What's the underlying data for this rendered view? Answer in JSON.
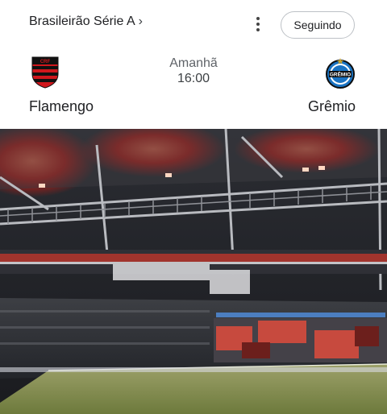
{
  "competition": {
    "label": "Brasileirão Série A",
    "chevron_icon": "chevron-right-icon"
  },
  "actions": {
    "follow_label": "Seguindo",
    "menu_icon": "more-vert-icon"
  },
  "match": {
    "home_team": "Flamengo",
    "away_team": "Grêmio",
    "date_label": "Amanhã",
    "time_label": "16:00"
  },
  "crests": {
    "away_text": "GRÊMIO"
  },
  "colors": {
    "flamengo_red": "#d0171c",
    "flamengo_black": "#111111",
    "gremio_blue": "#1a73c2",
    "gremio_black": "#0d0d0d"
  }
}
